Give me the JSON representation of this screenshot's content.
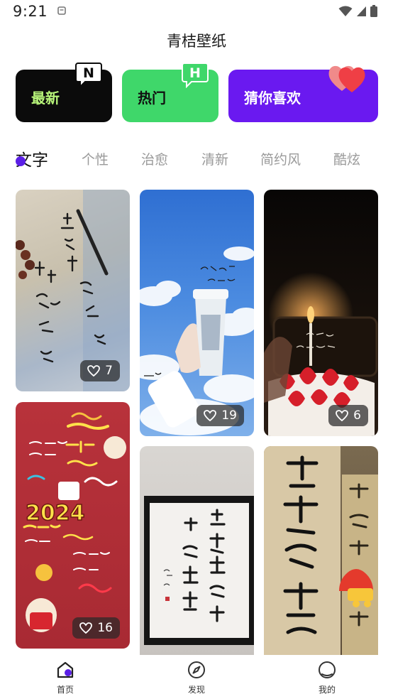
{
  "status": {
    "time": "9:21"
  },
  "app": {
    "title": "青桔壁纸"
  },
  "categories": [
    {
      "label": "最新",
      "badge": "N"
    },
    {
      "label": "热门",
      "badge": "H"
    },
    {
      "label": "猜你喜欢"
    }
  ],
  "tabs": [
    "文字",
    "个性",
    "治愈",
    "清新",
    "简约风",
    "酷炫"
  ],
  "wallpapers": [
    {
      "likes": "7"
    },
    {
      "likes": "19"
    },
    {
      "likes": "6"
    },
    {
      "likes": "16"
    }
  ],
  "nav": [
    {
      "label": "首页",
      "icon": "home-icon"
    },
    {
      "label": "发现",
      "icon": "compass-icon"
    },
    {
      "label": "我的",
      "icon": "profile-icon"
    }
  ],
  "colors": {
    "cat_new_bg": "#0b0b0b",
    "cat_new_text": "#b8f57a",
    "cat_hot_bg": "#3fd76a",
    "cat_guess_bg": "#6a19f0",
    "tab_dot": "#5b1fe6"
  }
}
